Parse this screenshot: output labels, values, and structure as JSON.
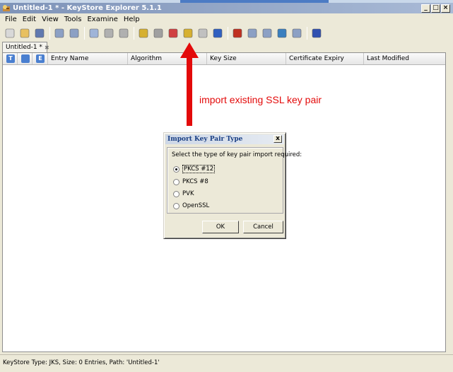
{
  "window": {
    "title": "Untitled-1 * - KeyStore Explorer 5.1.1",
    "controls": [
      "_",
      "□",
      "×"
    ]
  },
  "menu": [
    "File",
    "Edit",
    "View",
    "Tools",
    "Examine",
    "Help"
  ],
  "toolbar_icons": [
    {
      "name": "new-keystore-icon",
      "color": "#d8d8d8"
    },
    {
      "name": "open-keystore-icon",
      "color": "#e8c060"
    },
    {
      "name": "save-keystore-icon",
      "color": "#6079b0"
    },
    {
      "name": "undo-icon",
      "color": "#8ca0c4"
    },
    {
      "name": "redo-icon",
      "color": "#8ca0c4"
    },
    {
      "name": "cut-icon",
      "color": "#9fb4d8"
    },
    {
      "name": "copy-icon",
      "color": "#b0b0b0"
    },
    {
      "name": "paste-icon",
      "color": "#b0b0b0"
    },
    {
      "name": "generate-key-pair-icon",
      "color": "#d6b030"
    },
    {
      "name": "generate-secret-key-icon",
      "color": "#a0a0a0"
    },
    {
      "name": "import-trusted-certificate-icon",
      "color": "#d04040"
    },
    {
      "name": "import-key-pair-icon",
      "color": "#d6b030"
    },
    {
      "name": "set-password-icon",
      "color": "#c0c0c0"
    },
    {
      "name": "keystore-properties-icon",
      "color": "#3060c0"
    },
    {
      "name": "examine-file-icon",
      "color": "#c03020"
    },
    {
      "name": "examine-clipboard-icon",
      "color": "#8ca0c4"
    },
    {
      "name": "examine-ssl-icon",
      "color": "#8ca0c4"
    },
    {
      "name": "examine-crl-icon",
      "color": "#3a7fbf"
    },
    {
      "name": "examine-csr-icon",
      "color": "#8ca0c4"
    },
    {
      "name": "help-icon",
      "color": "#3050b0"
    }
  ],
  "tab": {
    "label": "Untitled-1 *",
    "close": "✖"
  },
  "table": {
    "icon_columns": [
      {
        "glyph": "T",
        "color": "#4a7fd0"
      },
      {
        "glyph": "🔒",
        "color": "#4a7fd0"
      },
      {
        "glyph": "E",
        "color": "#4a7fd0"
      }
    ],
    "columns": [
      "Entry Name",
      "Algorithm",
      "Key Size",
      "Certificate Expiry",
      "Last Modified"
    ]
  },
  "annotation": {
    "text": "import existing SSL key pair",
    "color": "#e30a0a"
  },
  "dialog": {
    "title": "Import Key Pair Type",
    "close": "x",
    "prompt": "Select the type of key pair import required:",
    "options": [
      "PKCS #12",
      "PKCS #8",
      "PVK",
      "OpenSSL"
    ],
    "selected": "PKCS #12",
    "ok": "OK",
    "cancel": "Cancel"
  },
  "status": "KeyStore Type: JKS, Size: 0 Entries, Path: 'Untitled-1'"
}
